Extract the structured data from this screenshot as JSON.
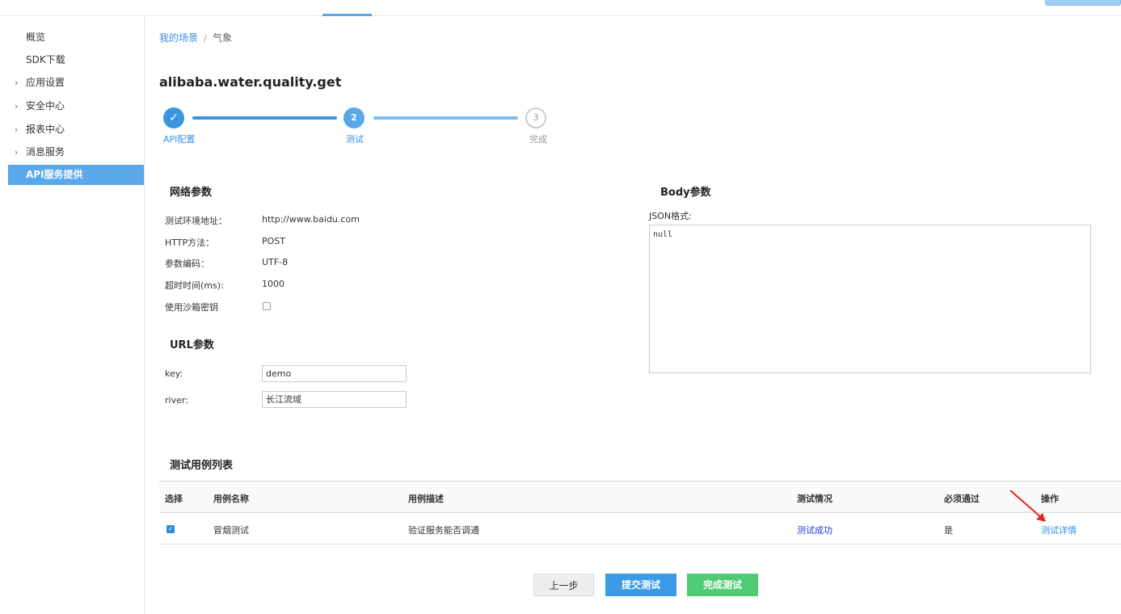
{
  "sidebar": {
    "items": [
      {
        "label": "概览",
        "expandable": false,
        "active": false
      },
      {
        "label": "SDK下载",
        "expandable": false,
        "active": false
      },
      {
        "label": "应用设置",
        "expandable": true,
        "active": false
      },
      {
        "label": "安全中心",
        "expandable": true,
        "active": false
      },
      {
        "label": "报表中心",
        "expandable": true,
        "active": false
      },
      {
        "label": "消息服务",
        "expandable": true,
        "active": false
      },
      {
        "label": "API服务提供",
        "expandable": false,
        "active": true
      }
    ]
  },
  "breadcrumb": {
    "link": "我的场景",
    "separator": "/",
    "current": "气象"
  },
  "page_title": "alibaba.water.quality.get",
  "steps": [
    {
      "number": "✓",
      "label": "API配置",
      "state": "done"
    },
    {
      "number": "2",
      "label": "测试",
      "state": "current"
    },
    {
      "number": "3",
      "label": "完成",
      "state": "todo"
    }
  ],
  "network_params": {
    "title": "网络参数",
    "fields": [
      {
        "label": "测试环境地址：",
        "value": "http://www.baidu.com"
      },
      {
        "label": "HTTP方法：",
        "value": "POST"
      },
      {
        "label": "参数编码：",
        "value": "UTF-8"
      },
      {
        "label": "超时时间(ms):",
        "value": "1000"
      },
      {
        "label": "使用沙箱密钥",
        "value": ""
      }
    ],
    "sandbox_checked": false
  },
  "url_params": {
    "title": "URL参数",
    "fields": [
      {
        "label": "key:",
        "value": "demo"
      },
      {
        "label": "river:",
        "value": "长江流域"
      }
    ]
  },
  "body_params": {
    "title": "Body参数",
    "format_label": "JSON格式:",
    "json_value": "null"
  },
  "test_cases": {
    "title": "测试用例列表",
    "columns": [
      "选择",
      "用例名称",
      "用例描述",
      "测试情况",
      "必须通过",
      "操作"
    ],
    "rows": [
      {
        "checked": true,
        "name": "冒烟测试",
        "description": "验证服务能否调通",
        "status": "测试成功",
        "required": "是",
        "action": "测试详情"
      }
    ]
  },
  "buttons": {
    "prev": "上一步",
    "submit": "提交测试",
    "finish": "完成测试"
  },
  "colors": {
    "accent": "#5aa7ea",
    "success_green": "#4fcb74",
    "link": "#3a8ee6",
    "annotation_arrow": "#e8231f"
  }
}
